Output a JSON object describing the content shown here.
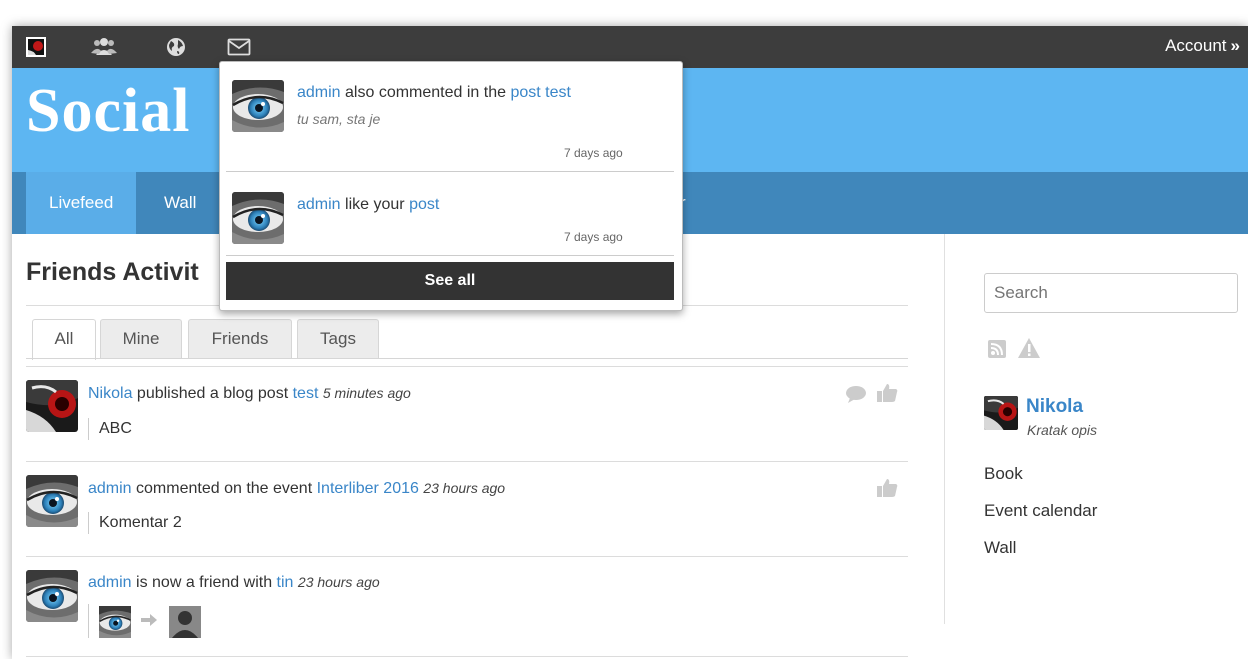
{
  "topbar": {
    "icons": [
      "site-logo-icon",
      "people-icon",
      "globe-icon",
      "envelope-icon"
    ],
    "account_label": "Account",
    "account_arrow": "»"
  },
  "header": {
    "site_title": "Social"
  },
  "nav": {
    "items": [
      "Livefeed",
      "Wall",
      "r"
    ]
  },
  "notifications": {
    "items": [
      {
        "actor": "admin",
        "text": "also commented in the",
        "target": "post test",
        "snippet": "tu sam, sta je",
        "time": "7 days ago"
      },
      {
        "actor": "admin",
        "text": "like your",
        "target": "post",
        "snippet": "",
        "time": "7 days ago"
      }
    ],
    "see_all_label": "See all"
  },
  "main": {
    "title": "Friends Activit",
    "tabs": [
      "All",
      "Mine",
      "Friends",
      "Tags"
    ],
    "feed": [
      {
        "actor": "Nikola",
        "text": "published a blog post",
        "target": "test",
        "time": "5 minutes ago",
        "content": "ABC"
      },
      {
        "actor": "admin",
        "text": "commented on the event",
        "target": "Interliber 2016",
        "time": "23 hours ago",
        "content": "Komentar 2"
      },
      {
        "actor": "admin",
        "text": "is now a friend with",
        "target": "tin",
        "time": "23 hours ago",
        "content": ""
      }
    ]
  },
  "sidebar": {
    "search_placeholder": "Search",
    "profile_name": "Nikola",
    "profile_desc": "Kratak opis",
    "links": [
      "Book",
      "Event calendar",
      "Wall"
    ]
  },
  "colors": {
    "topbar": "#3d3d3d",
    "header": "#5db6f2",
    "nav": "#4087bb",
    "nav_active": "#5aade8",
    "link": "#3a86c8"
  }
}
